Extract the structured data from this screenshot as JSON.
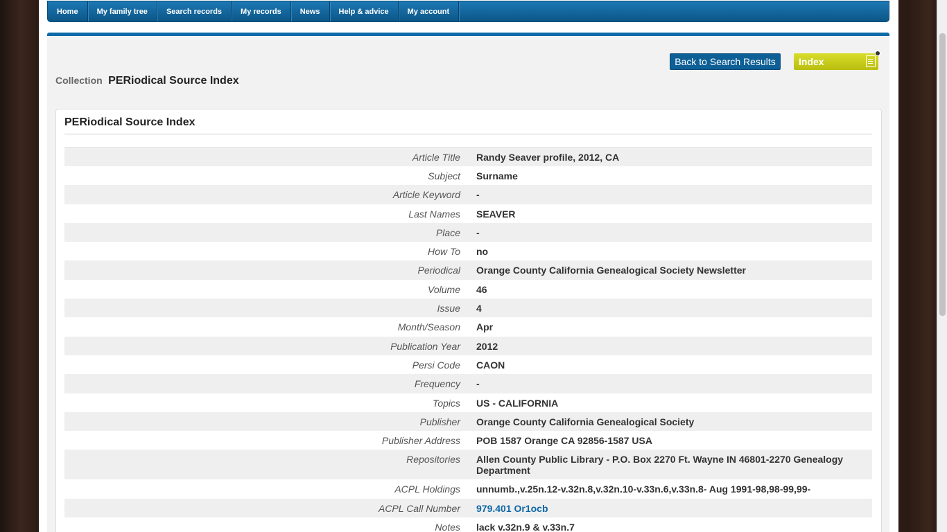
{
  "nav": {
    "items": [
      "Home",
      "My family tree",
      "Search records",
      "My records",
      "News",
      "Help & advice",
      "My account"
    ]
  },
  "header": {
    "collection_label": "Collection",
    "collection_name": "PERiodical Source Index",
    "back_button": "Back to Search Results",
    "index_button": "Index"
  },
  "panel": {
    "title": "PERiodical Source Index"
  },
  "details": [
    {
      "label": "Article Title",
      "value": "Randy Seaver profile, 2012, CA"
    },
    {
      "label": "Subject",
      "value": "Surname"
    },
    {
      "label": "Article Keyword",
      "value": "-"
    },
    {
      "label": "Last Names",
      "value": "SEAVER"
    },
    {
      "label": "Place",
      "value": "-"
    },
    {
      "label": "How To",
      "value": "no"
    },
    {
      "label": "Periodical",
      "value": "Orange County California Genealogical Society Newsletter"
    },
    {
      "label": "Volume",
      "value": "46"
    },
    {
      "label": "Issue",
      "value": "4"
    },
    {
      "label": "Month/Season",
      "value": "Apr"
    },
    {
      "label": "Publication Year",
      "value": "2012"
    },
    {
      "label": "Persi Code",
      "value": "CAON"
    },
    {
      "label": "Frequency",
      "value": "-"
    },
    {
      "label": "Topics",
      "value": "US - CALIFORNIA"
    },
    {
      "label": "Publisher",
      "value": "Orange County California Genealogical Society"
    },
    {
      "label": "Publisher Address",
      "value": "POB 1587 Orange CA 92856-1587 USA"
    },
    {
      "label": "Repositories",
      "value": "Allen County Public Library - P.O. Box 2270 Ft. Wayne IN 46801-2270 Genealogy Department"
    },
    {
      "label": "ACPL Holdings",
      "value": "unnumb.,v.25n.12-v.32n.8,v.32n.10-v.33n.6,v.33n.8- Aug 1991-98,98-99,99-"
    },
    {
      "label": "ACPL Call Number",
      "value": "979.401 Or1ocb"
    },
    {
      "label": "Notes",
      "value": "lack v.32n.9 & v.33n.7"
    }
  ],
  "colors": {
    "nav_blue": "#0c5688",
    "index_yellow": "#c9ce1e",
    "link_blue": "#0d67a6"
  }
}
